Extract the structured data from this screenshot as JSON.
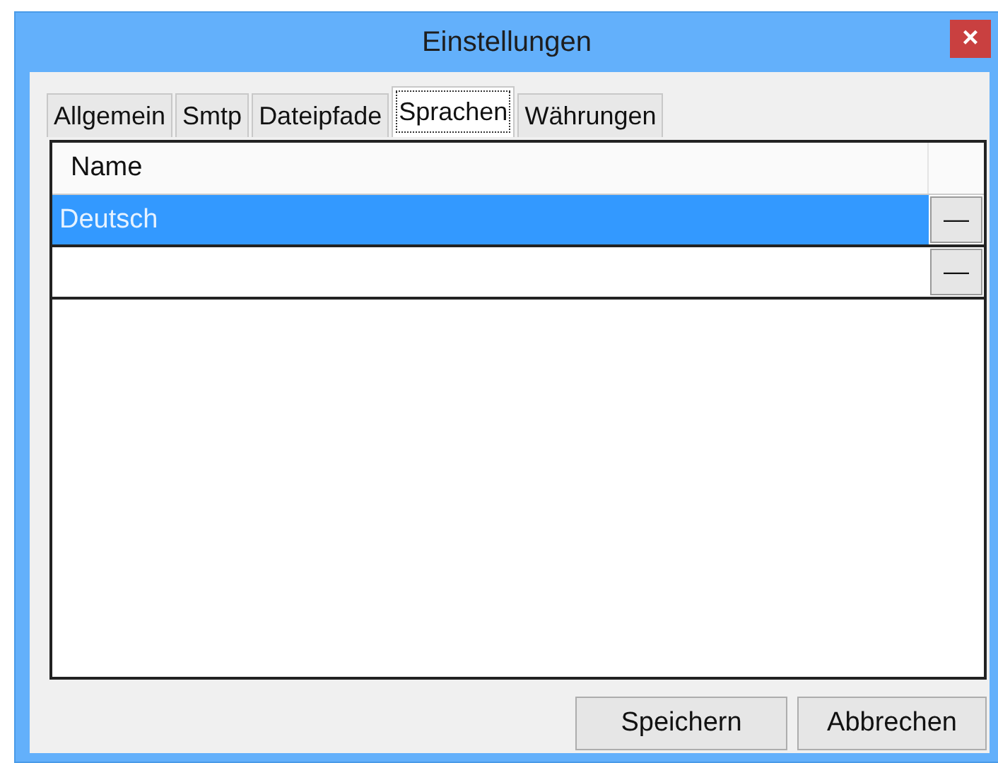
{
  "window": {
    "title": "Einstellungen",
    "close": "×"
  },
  "tabs": [
    {
      "label": "Allgemein",
      "selected": false
    },
    {
      "label": "Smtp",
      "selected": false
    },
    {
      "label": "Dateipfade",
      "selected": false
    },
    {
      "label": "Sprachen",
      "selected": true
    },
    {
      "label": "Währungen",
      "selected": false
    }
  ],
  "table": {
    "columns": [
      "Name"
    ],
    "rows": [
      {
        "name": "Deutsch",
        "selected": true,
        "remove": "—"
      },
      {
        "selected": false,
        "remove": "—"
      }
    ]
  },
  "buttons": [
    "Speichern",
    "Abbrechen"
  ]
}
